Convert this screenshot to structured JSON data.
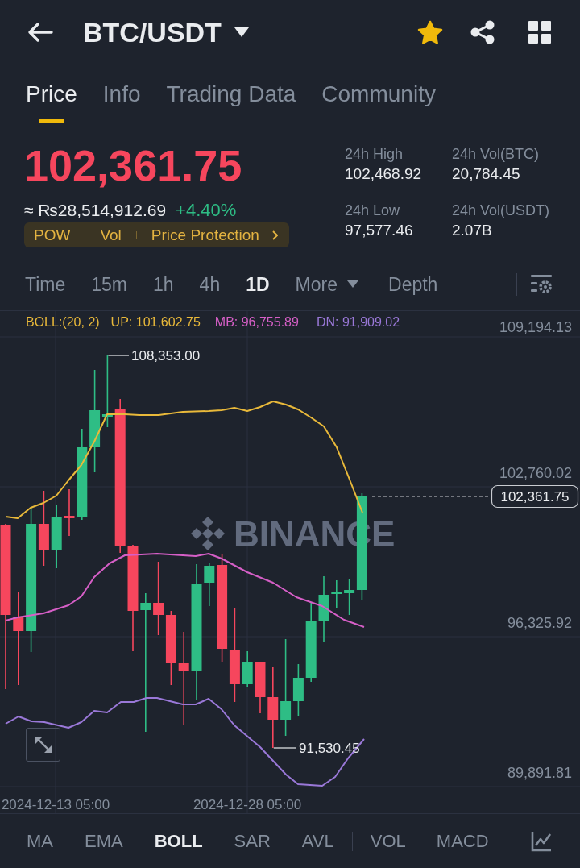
{
  "header": {
    "title": "BTC/USDT",
    "favorite": true
  },
  "tabs": [
    {
      "label": "Price",
      "selected": true
    },
    {
      "label": "Info",
      "selected": false
    },
    {
      "label": "Trading Data",
      "selected": false
    },
    {
      "label": "Community",
      "selected": false
    }
  ],
  "ticker": {
    "last_price": "102,361.75",
    "last_price_rising": false,
    "fiat_price": "≈ ₨28,514,912.69",
    "change": "+4.40%",
    "change_rising": true,
    "tags": [
      "POW",
      "Vol",
      "Price Protection"
    ]
  },
  "stats": [
    {
      "label": "24h High",
      "value": "102,468.92"
    },
    {
      "label": "24h Vol(BTC)",
      "value": "20,784.45"
    },
    {
      "label": "24h Low",
      "value": "97,577.46"
    },
    {
      "label": "24h Vol(USDT)",
      "value": "2.07B"
    }
  ],
  "intervals": [
    {
      "label": "Time",
      "kind": "interval",
      "selected": false
    },
    {
      "label": "15m",
      "kind": "interval",
      "selected": false
    },
    {
      "label": "1h",
      "kind": "interval",
      "selected": false
    },
    {
      "label": "4h",
      "kind": "interval",
      "selected": false
    },
    {
      "label": "1D",
      "kind": "interval",
      "selected": true
    },
    {
      "label": "More",
      "kind": "menu",
      "selected": false
    },
    {
      "label": "Depth",
      "kind": "view",
      "selected": false
    }
  ],
  "chart": {
    "legend": [
      {
        "text": "BOLL:(20, 2)",
        "color": "#e9b93a"
      },
      {
        "text": "UP: 101,602.75",
        "color": "#e9b93a"
      },
      {
        "text": "MB: 96,755.89",
        "color": "#d65fc7"
      },
      {
        "text": "DN: 91,909.02",
        "color": "#9a78d8"
      }
    ],
    "price_axis": [
      "109,194.13",
      "102,760.02",
      "96,325.92",
      "89,891.81"
    ],
    "date_axis": [
      "2024-12-13 05:00",
      "2024-12-28 05:00"
    ],
    "high_label": "108,353.00",
    "low_label": "91,530.45",
    "current_price": "102,361.75",
    "watermark": "BINANCE"
  },
  "main_indicators": [
    {
      "label": "MA",
      "selected": false
    },
    {
      "label": "EMA",
      "selected": false
    },
    {
      "label": "BOLL",
      "selected": true
    },
    {
      "label": "SAR",
      "selected": false
    },
    {
      "label": "AVL",
      "selected": false
    }
  ],
  "sub_indicators": [
    {
      "label": "VOL",
      "selected": false
    },
    {
      "label": "MACD",
      "selected": false
    }
  ]
}
